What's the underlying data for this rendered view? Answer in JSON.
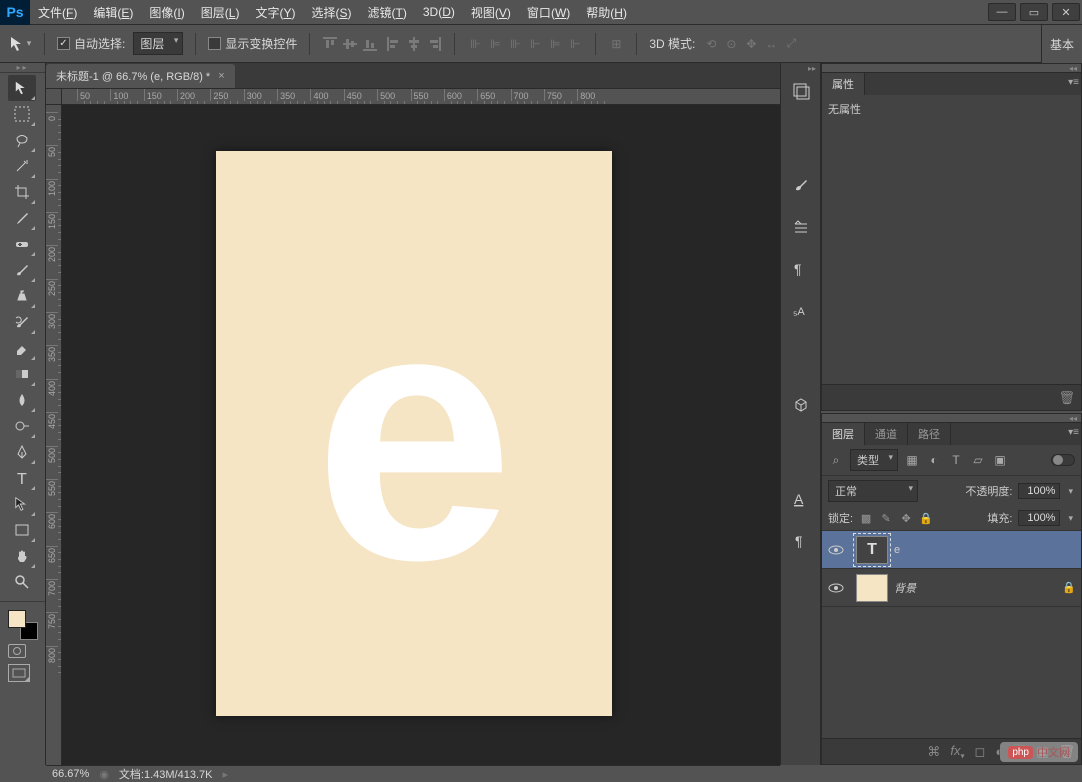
{
  "app": {
    "logo": "Ps"
  },
  "menu": [
    {
      "label": "文件",
      "key": "F"
    },
    {
      "label": "编辑",
      "key": "E"
    },
    {
      "label": "图像",
      "key": "I"
    },
    {
      "label": "图层",
      "key": "L"
    },
    {
      "label": "文字",
      "key": "Y"
    },
    {
      "label": "选择",
      "key": "S"
    },
    {
      "label": "滤镜",
      "key": "T"
    },
    {
      "label": "3D",
      "key": "D"
    },
    {
      "label": "视图",
      "key": "V"
    },
    {
      "label": "窗口",
      "key": "W"
    },
    {
      "label": "帮助",
      "key": "H"
    }
  ],
  "options": {
    "auto_select_label": "自动选择:",
    "auto_select_mode": "图层",
    "show_transform_label": "显示变换控件",
    "mode_3d_label": "3D 模式:",
    "basic_label": "基本"
  },
  "document": {
    "tab_title": "未标题-1 @ 66.7% (e, RGB/8) *",
    "glyph": "e"
  },
  "ruler_h": [
    50,
    100,
    150,
    200,
    250,
    300,
    350,
    400,
    450,
    500,
    550,
    600,
    650,
    700,
    750,
    800
  ],
  "ruler_v": [
    0,
    50,
    100,
    150,
    200,
    250,
    300,
    350,
    400,
    450,
    500,
    550,
    600,
    650,
    700,
    750,
    800
  ],
  "colors": {
    "foreground": "#f5e5c5",
    "background": "#000000",
    "canvas": "#f5e5c5"
  },
  "panels": {
    "properties": {
      "tab": "属性",
      "empty_text": "无属性"
    },
    "layers": {
      "tabs": [
        "图层",
        "通道",
        "路径"
      ],
      "filter_label": "类型",
      "blend_mode": "正常",
      "opacity_label": "不透明度:",
      "opacity_value": "100%",
      "lock_label": "锁定:",
      "fill_label": "填充:",
      "fill_value": "100%",
      "items": [
        {
          "name": "e",
          "type": "text",
          "visible": true,
          "selected": true,
          "locked": false
        },
        {
          "name": "背景",
          "type": "raster",
          "visible": true,
          "selected": false,
          "locked": true
        }
      ]
    }
  },
  "status": {
    "zoom": "66.67%",
    "doc_label": "文档:",
    "doc_size": "1.43M/413.7K"
  },
  "watermark": "中文网"
}
